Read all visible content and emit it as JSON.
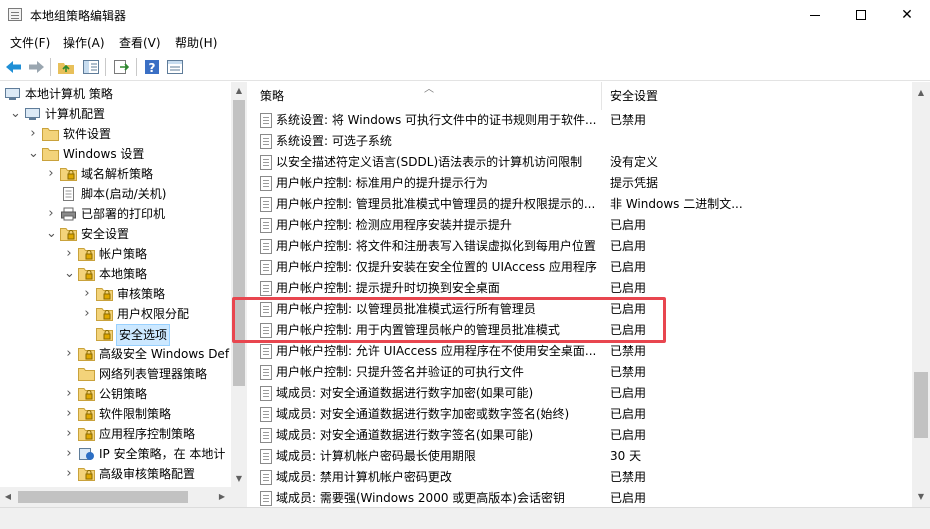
{
  "window": {
    "title": "本地组策略编辑器",
    "controls": {
      "minimize": "—",
      "maximize": "☐",
      "close": "✕"
    }
  },
  "menu": [
    "文件(F)",
    "操作(A)",
    "查看(V)",
    "帮助(H)"
  ],
  "toolbar": [
    "back-arrow",
    "forward-arrow",
    "up-folder",
    "show-hide-tree",
    "export-list",
    "help",
    "properties"
  ],
  "tree": [
    {
      "label": "本地计算机 策略",
      "level": 0,
      "toggle": ""
    },
    {
      "label": "计算机配置",
      "level": 0,
      "toggle": "v"
    },
    {
      "label": "软件设置",
      "level": 1,
      "toggle": ">"
    },
    {
      "label": "Windows 设置",
      "level": 1,
      "toggle": "v"
    },
    {
      "label": "域名解析策略",
      "level": 2,
      "toggle": ">"
    },
    {
      "label": "脚本(启动/关机)",
      "level": 2,
      "toggle": ""
    },
    {
      "label": "已部署的打印机",
      "level": 2,
      "toggle": ">"
    },
    {
      "label": "安全设置",
      "level": 2,
      "toggle": "v"
    },
    {
      "label": "帐户策略",
      "level": 3,
      "toggle": ">"
    },
    {
      "label": "本地策略",
      "level": 3,
      "toggle": "v"
    },
    {
      "label": "审核策略",
      "level": 4,
      "toggle": ">"
    },
    {
      "label": "用户权限分配",
      "level": 4,
      "toggle": ">"
    },
    {
      "label": "安全选项",
      "level": 4,
      "toggle": "",
      "selected": true
    },
    {
      "label": "高级安全 Windows Def",
      "level": 3,
      "toggle": ">"
    },
    {
      "label": "网络列表管理器策略",
      "level": 3,
      "toggle": ""
    },
    {
      "label": "公钥策略",
      "level": 3,
      "toggle": ">"
    },
    {
      "label": "软件限制策略",
      "level": 3,
      "toggle": ">"
    },
    {
      "label": "应用程序控制策略",
      "level": 3,
      "toggle": ">"
    },
    {
      "label": "IP 安全策略，在 本地计",
      "level": 3,
      "toggle": ">"
    },
    {
      "label": "高级审核策略配置",
      "level": 3,
      "toggle": ">"
    }
  ],
  "columns": {
    "policy": "策略",
    "setting": "安全设置"
  },
  "policies": [
    {
      "name": "系统设置: 将 Windows 可执行文件中的证书规则用于软件...",
      "setting": "已禁用"
    },
    {
      "name": "系统设置: 可选子系统",
      "setting": ""
    },
    {
      "name": "以安全描述符定义语言(SDDL)语法表示的计算机访问限制",
      "setting": "没有定义"
    },
    {
      "name": "用户帐户控制: 标准用户的提升提示行为",
      "setting": "提示凭据"
    },
    {
      "name": "用户帐户控制: 管理员批准模式中管理员的提升权限提示的...",
      "setting": "非 Windows 二进制文..."
    },
    {
      "name": "用户帐户控制: 检测应用程序安装并提示提升",
      "setting": "已启用"
    },
    {
      "name": "用户帐户控制: 将文件和注册表写入错误虚拟化到每用户位置",
      "setting": "已启用"
    },
    {
      "name": "用户帐户控制: 仅提升安装在安全位置的 UIAccess 应用程序",
      "setting": "已启用"
    },
    {
      "name": "用户帐户控制: 提示提升时切换到安全桌面",
      "setting": "已启用"
    },
    {
      "name": "用户帐户控制: 以管理员批准模式运行所有管理员",
      "setting": "已启用"
    },
    {
      "name": "用户帐户控制: 用于内置管理员帐户的管理员批准模式",
      "setting": "已启用"
    },
    {
      "name": "用户帐户控制: 允许 UIAccess 应用程序在不使用安全桌面...",
      "setting": "已禁用"
    },
    {
      "name": "用户帐户控制: 只提升签名并验证的可执行文件",
      "setting": "已禁用"
    },
    {
      "name": "域成员: 对安全通道数据进行数字加密(如果可能)",
      "setting": "已启用"
    },
    {
      "name": "域成员: 对安全通道数据进行数字加密或数字签名(始终)",
      "setting": "已启用"
    },
    {
      "name": "域成员: 对安全通道数据进行数字签名(如果可能)",
      "setting": "已启用"
    },
    {
      "name": "域成员: 计算机帐户密码最长使用期限",
      "setting": "30 天"
    },
    {
      "name": "域成员: 禁用计算机帐户密码更改",
      "setting": "已禁用"
    },
    {
      "name": "域成员: 需要强(Windows 2000 或更高版本)会话密钥",
      "setting": "已启用"
    }
  ],
  "highlight_color": "#e8464f",
  "selection_color": "#cce8ff"
}
